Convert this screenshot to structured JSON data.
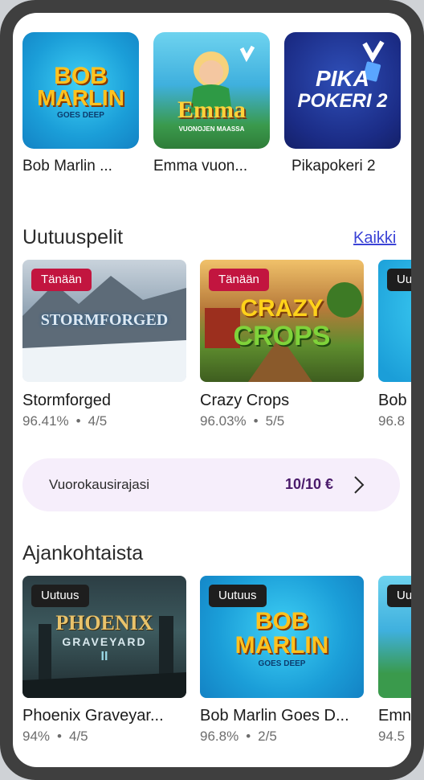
{
  "colors": {
    "frame": "#3f3f3f",
    "screen_bg": "#ffffff",
    "link": "#3b43d6",
    "badge_today": "#c2153f",
    "badge_new": "#1e1e1e",
    "limit_bg": "#f6eefb",
    "limit_value": "#4a1a6b"
  },
  "top_games": [
    {
      "title": "Bob Marlin ...",
      "logo_line1": "BOB",
      "logo_line2": "MARLIN",
      "logo_line3": "GOES DEEP",
      "icon": "bob-marlin-art"
    },
    {
      "title": "Emma vuon...",
      "logo_line1": "Emma",
      "logo_line2": "VUONOJEN MAASSA",
      "icon": "emma-art"
    },
    {
      "title": "Pikapokeri 2",
      "logo_line1": "PIKA",
      "logo_line2": "POKERI 2",
      "icon": "pikapokeri-art"
    }
  ],
  "new_games": {
    "heading": "Uutuuspelit",
    "all_link": "Kaikki",
    "cards": [
      {
        "badge": "Tänään",
        "logo": "STORMFORGED",
        "title": "Stormforged",
        "rtp": "96.41%",
        "rating": "4/5"
      },
      {
        "badge": "Tänään",
        "logo_line1": "CRAZY",
        "logo_line2": "CROPS",
        "title": "Crazy Crops",
        "rtp": "96.03%",
        "rating": "5/5"
      },
      {
        "badge": "Uu",
        "title": "Bob",
        "rtp": "96.8"
      }
    ]
  },
  "daily_limit": {
    "label": "Vuorokausirajasi",
    "value": "10/10 €"
  },
  "current_games": {
    "heading": "Ajankohtaista",
    "cards": [
      {
        "badge": "Uutuus",
        "logo_line1": "PHOENIX",
        "logo_line2": "GRAVEYARD",
        "logo_line3": "II",
        "title": "Phoenix Graveyar...",
        "rtp": "94%",
        "rating": "4/5"
      },
      {
        "badge": "Uutuus",
        "logo_line1": "BOB",
        "logo_line2": "MARLIN",
        "logo_line3": "GOES DEEP",
        "title": "Bob Marlin Goes D...",
        "rtp": "96.8%",
        "rating": "2/5"
      },
      {
        "badge": "Uu",
        "title": "Emn",
        "rtp": "94.5"
      }
    ]
  }
}
